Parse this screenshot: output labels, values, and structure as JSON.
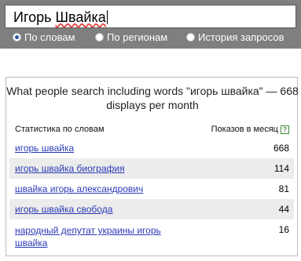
{
  "search": {
    "query_word1": "Игорь",
    "query_word2": "Швайка"
  },
  "radio_options": [
    {
      "label": "По словам",
      "checked": true
    },
    {
      "label": "По регионам",
      "checked": false
    },
    {
      "label": "История запросов",
      "checked": false
    }
  ],
  "results": {
    "title": "What people search including words \"игорь швайка\" — 668 displays per month",
    "col_left": "Статистика по словам",
    "col_right": "Показов в месяц",
    "help_glyph": "?",
    "rows": [
      {
        "phrase": "игорь швайка",
        "count": "668"
      },
      {
        "phrase": "игорь швайка биография",
        "count": "114"
      },
      {
        "phrase": "швайка игорь александрович",
        "count": "81"
      },
      {
        "phrase": "игорь швайка свобода",
        "count": "44"
      },
      {
        "phrase": "народный депутат украины игорь швайка",
        "count": "16"
      }
    ]
  },
  "colors": {
    "top_panel": "#7f7f7f",
    "link": "#2a3bb5",
    "shaded_row": "#ececec"
  }
}
